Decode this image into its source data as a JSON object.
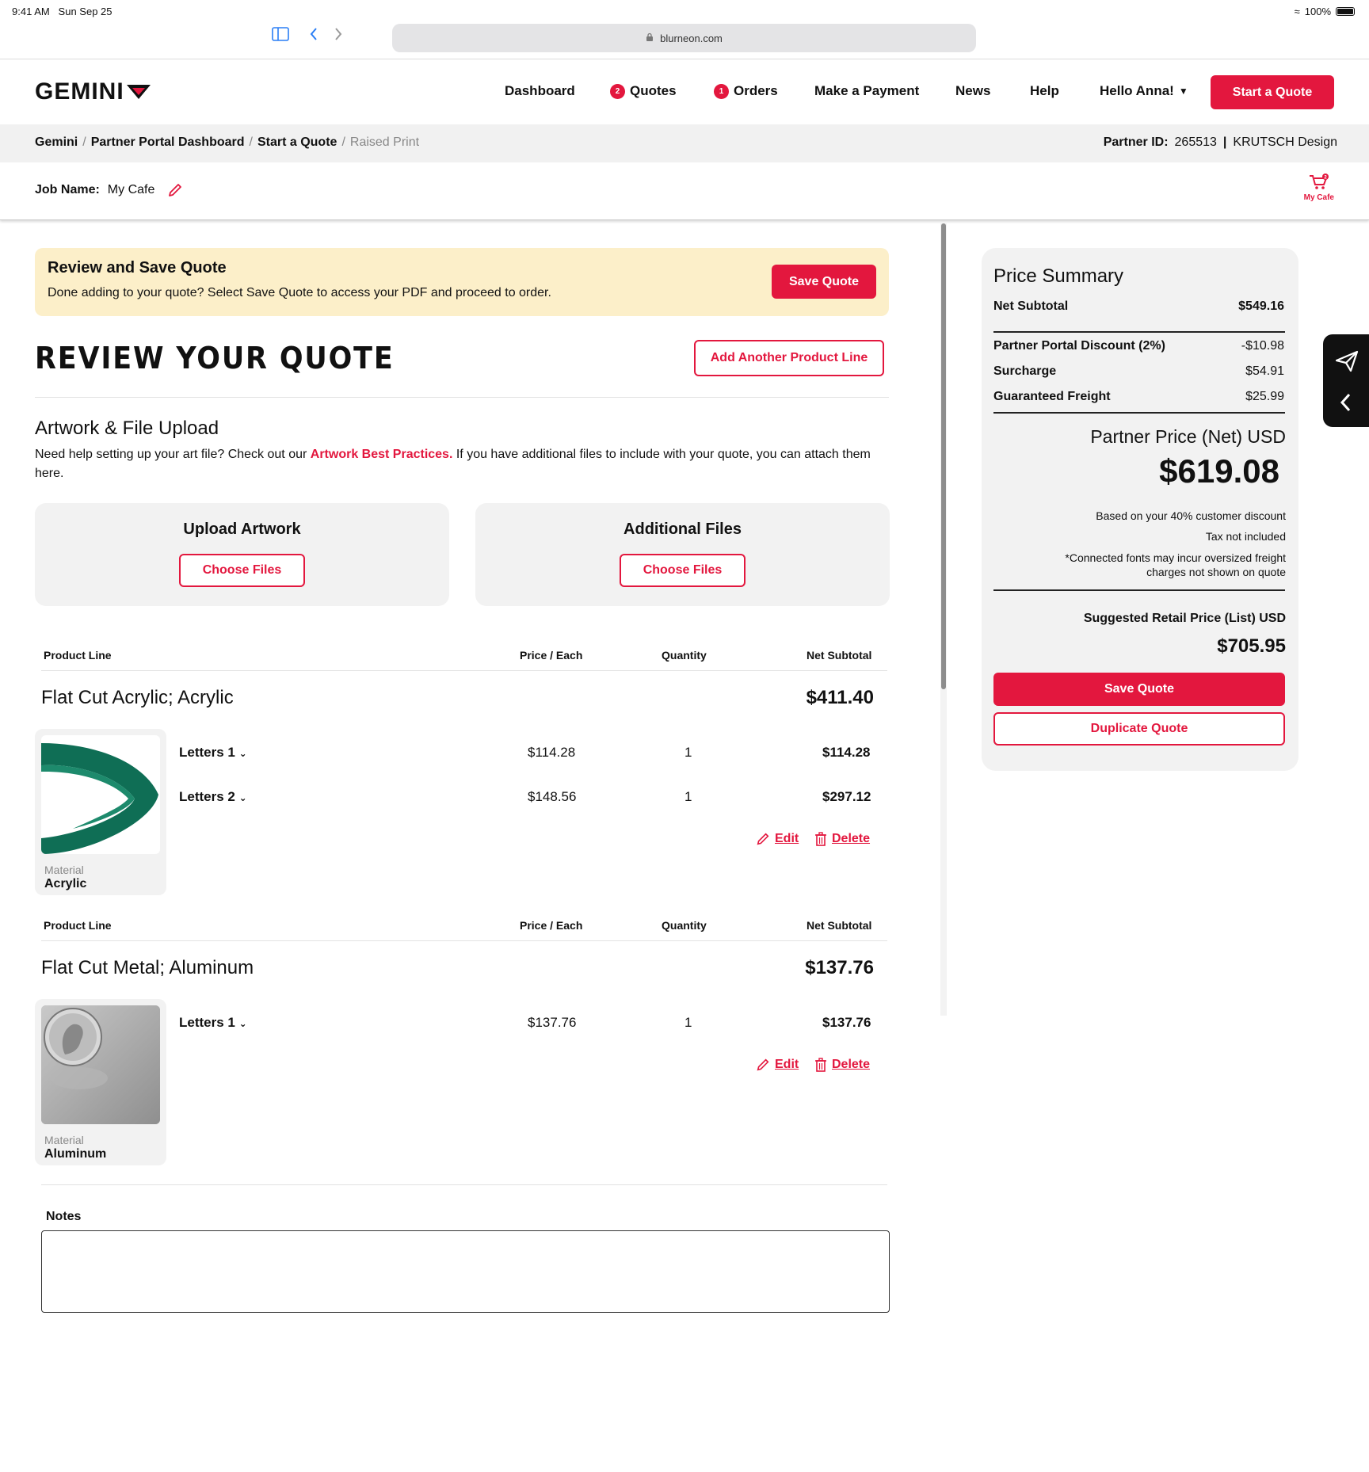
{
  "status_bar": {
    "time": "9:41 AM",
    "date": "Sun Sep 25",
    "battery": "100%"
  },
  "browser": {
    "url": "blurneon.com"
  },
  "header": {
    "logo": "GEMINI",
    "nav": {
      "dashboard": "Dashboard",
      "quotes": "Quotes",
      "quotes_badge": "2",
      "orders": "Orders",
      "orders_badge": "1",
      "payment": "Make a Payment",
      "news": "News",
      "help": "Help",
      "user": "Hello Anna!"
    },
    "start_quote": "Start a Quote"
  },
  "breadcrumb": {
    "items": [
      "Gemini",
      "Partner Portal Dashboard",
      "Start a Quote"
    ],
    "current": "Raised Print",
    "partner_label": "Partner ID:",
    "partner_id": "265513",
    "partner_sep": "|",
    "company": "KRUTSCH Design"
  },
  "job": {
    "label": "Job Name:",
    "value": "My Cafe",
    "cart_count": "2",
    "cart_label": "My Cafe"
  },
  "banner": {
    "title": "Review and Save Quote",
    "text": "Done adding to your quote? Select Save Quote to access your PDF and proceed to order.",
    "button": "Save Quote"
  },
  "review": {
    "title": "REVIEW YOUR QUOTE",
    "add_button": "Add Another Product Line"
  },
  "upload": {
    "title": "Artwork & File Upload",
    "desc_before": "Need help setting up your art file? Check out our ",
    "desc_link": "Artwork Best Practices.",
    "desc_after": " If you have additional files to include with your quote, you can attach them here.",
    "artwork_label": "Upload Artwork",
    "files_label": "Additional Files",
    "choose": "Choose Files"
  },
  "columns": {
    "product": "Product Line",
    "price": "Price / Each",
    "qty": "Quantity",
    "subtotal": "Net Subtotal"
  },
  "products": [
    {
      "title": "Flat Cut Acrylic; Acrylic",
      "total": "$411.40",
      "material_label": "Material",
      "material": "Acrylic",
      "lines": [
        {
          "name": "Letters 1",
          "price": "$114.28",
          "qty": "1",
          "subtotal": "$114.28"
        },
        {
          "name": "Letters 2",
          "price": "$148.56",
          "qty": "1",
          "subtotal": "$297.12"
        }
      ]
    },
    {
      "title": "Flat Cut Metal; Aluminum",
      "total": "$137.76",
      "material_label": "Material",
      "material": "Aluminum",
      "lines": [
        {
          "name": "Letters 1",
          "price": "$137.76",
          "qty": "1",
          "subtotal": "$137.76"
        }
      ]
    }
  ],
  "actions": {
    "edit": "Edit",
    "delete": "Delete"
  },
  "notes": {
    "label": "Notes",
    "value": ""
  },
  "summary": {
    "title": "Price Summary",
    "net_label": "Net Subtotal",
    "net_value": "$549.16",
    "discount_label": "Partner Portal Discount (2%)",
    "discount_value": "-$10.98",
    "surcharge_label": "Surcharge",
    "surcharge_value": "$54.91",
    "freight_label": "Guaranteed Freight",
    "freight_value": "$25.99",
    "partner_price_label": "Partner Price (Net) USD",
    "partner_price": "$619.08",
    "note1": "Based on your 40% customer discount",
    "note2": "Tax not included",
    "note3a": "*Connected fonts may incur oversized freight",
    "note3b": "charges not shown on quote",
    "retail_label": "Suggested Retail Price (List) USD",
    "retail_price": "$705.95",
    "save": "Save Quote",
    "duplicate": "Duplicate Quote"
  },
  "colors": {
    "accent": "#e3173e",
    "banner": "#fcefc9",
    "panel": "#f2f2f2"
  }
}
